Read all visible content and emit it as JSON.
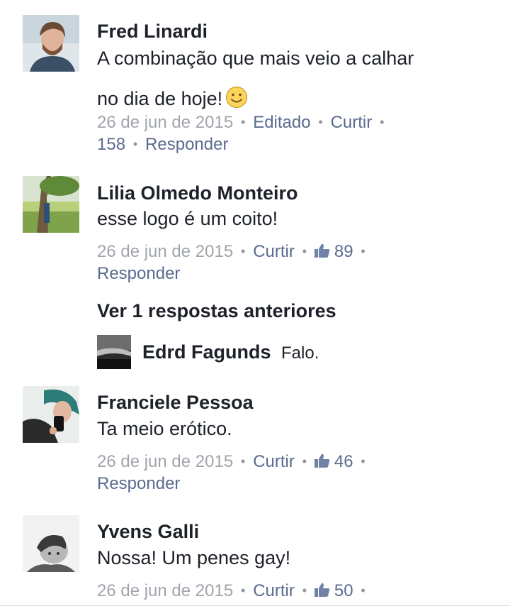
{
  "colors": {
    "name": "#1d2129",
    "meta": "#90949c",
    "link": "#5b6b8e"
  },
  "comments": [
    {
      "author": "Fred Linardi",
      "text_line1": "A combinação que mais veio a calhar",
      "text_line2": "no dia de hoje!",
      "emoji": "smiley-face",
      "date": "26 de jun de 2015",
      "edited": "Editado",
      "like": "Curtir",
      "likes": "158",
      "reply": "Responder"
    },
    {
      "author": "Lilia Olmedo Monteiro",
      "text": "esse logo é um coito!",
      "date": "26 de jun de 2015",
      "like": "Curtir",
      "likes": "89",
      "reply": "Responder"
    },
    {
      "author": "Franciele Pessoa",
      "text": "Ta meio erótico.",
      "date": "26 de jun de 2015",
      "like": "Curtir",
      "likes": "46",
      "reply": "Responder"
    },
    {
      "author": "Yvens Galli",
      "text": "Nossa! Um penes gay!",
      "date": "26 de jun de 2015",
      "like": "Curtir",
      "likes": "50"
    }
  ],
  "replies_section": {
    "view_previous": "Ver 1 respostas anteriores",
    "reply_author": "Edrd Fagunds",
    "reply_text": "Falo."
  },
  "icons": {
    "like": "thumbs-up-icon",
    "separator": "bullet-dot"
  }
}
